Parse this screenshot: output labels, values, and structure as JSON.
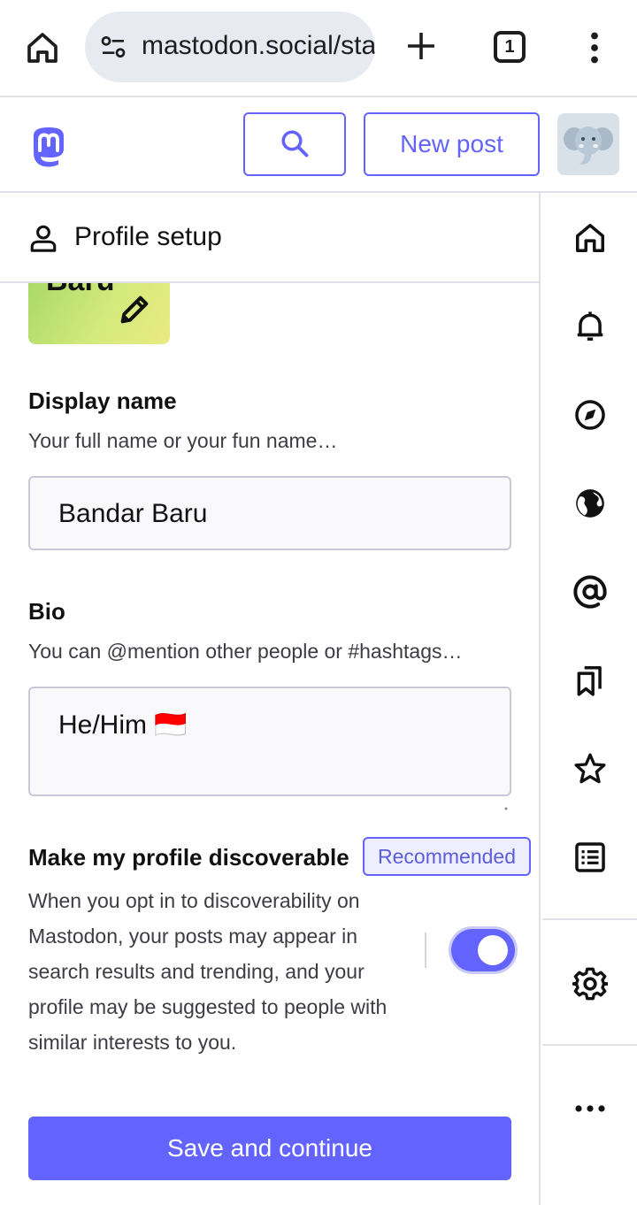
{
  "browser": {
    "url": "mastodon.social/sta",
    "tab_count": "1"
  },
  "header": {
    "new_post_label": "New post"
  },
  "column": {
    "title": "Profile setup"
  },
  "header_image": {
    "partial_text": "Baru"
  },
  "display_name": {
    "label": "Display name",
    "hint": "Your full name or your fun name…",
    "value": "Bandar Baru"
  },
  "bio": {
    "label": "Bio",
    "hint": "You can @mention other people or #hashtags…",
    "value": "He/Him 🇮🇩"
  },
  "discoverable": {
    "label": "Make my profile discoverable",
    "badge": "Recommended",
    "description": "When you opt in to discoverability on Mastodon, your posts may appear in search results and trending, and your profile may be suggested to people with similar interests to you.",
    "enabled": true
  },
  "actions": {
    "save_label": "Save and continue"
  },
  "nav_icons": [
    "home-icon",
    "bell-icon",
    "compass-icon",
    "globe-icon",
    "at-icon",
    "bookmarks-icon",
    "star-icon",
    "list-icon",
    "gear-icon",
    "more-icon"
  ],
  "colors": {
    "accent": "#6364ff",
    "badge_bg": "#eeeeff",
    "field_bg": "#f9f9fb",
    "url_bar_bg": "#e8eaf2"
  }
}
